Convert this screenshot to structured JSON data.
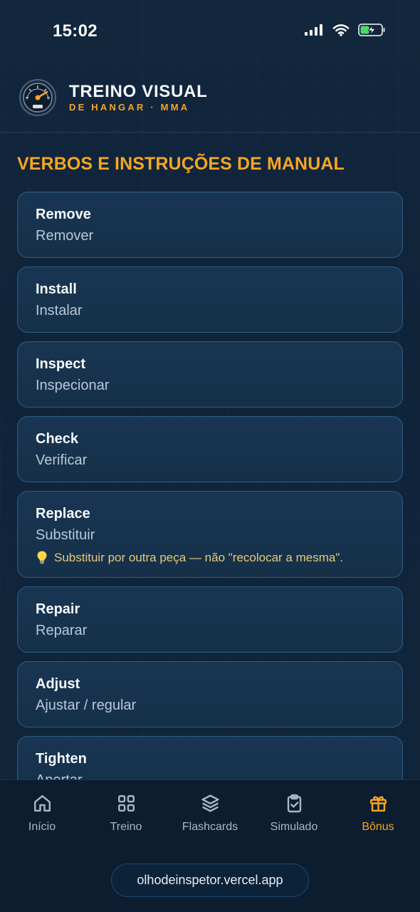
{
  "status": {
    "time": "15:02"
  },
  "header": {
    "title": "TREINO VISUAL",
    "subtitle": "DE HANGAR · MMA"
  },
  "section": {
    "title": "VERBOS E INSTRUÇÕES DE MANUAL"
  },
  "cards": [
    {
      "term": "Remove",
      "translation": "Remover"
    },
    {
      "term": "Install",
      "translation": "Instalar"
    },
    {
      "term": "Inspect",
      "translation": "Inspecionar"
    },
    {
      "term": "Check",
      "translation": "Verificar"
    },
    {
      "term": "Replace",
      "translation": "Substituir",
      "tip": "Substituir por outra peça — não \"recolocar a mesma\"."
    },
    {
      "term": "Repair",
      "translation": "Reparar"
    },
    {
      "term": "Adjust",
      "translation": "Ajustar / regular"
    },
    {
      "term": "Tighten",
      "translation": "Apertar"
    }
  ],
  "nav": {
    "items": [
      {
        "label": "Início",
        "icon": "home-icon"
      },
      {
        "label": "Treino",
        "icon": "grid-icon"
      },
      {
        "label": "Flashcards",
        "icon": "layers-icon"
      },
      {
        "label": "Simulado",
        "icon": "clipboard-check-icon"
      },
      {
        "label": "Bônus",
        "icon": "gift-icon",
        "active": true
      }
    ]
  },
  "browser": {
    "url": "olhodeinspetor.vercel.app"
  },
  "colors": {
    "background": "#10253b",
    "accent": "#f5a623",
    "card": "#183553",
    "card_border": "#2b5b83",
    "tip_text": "#e8c97c"
  }
}
